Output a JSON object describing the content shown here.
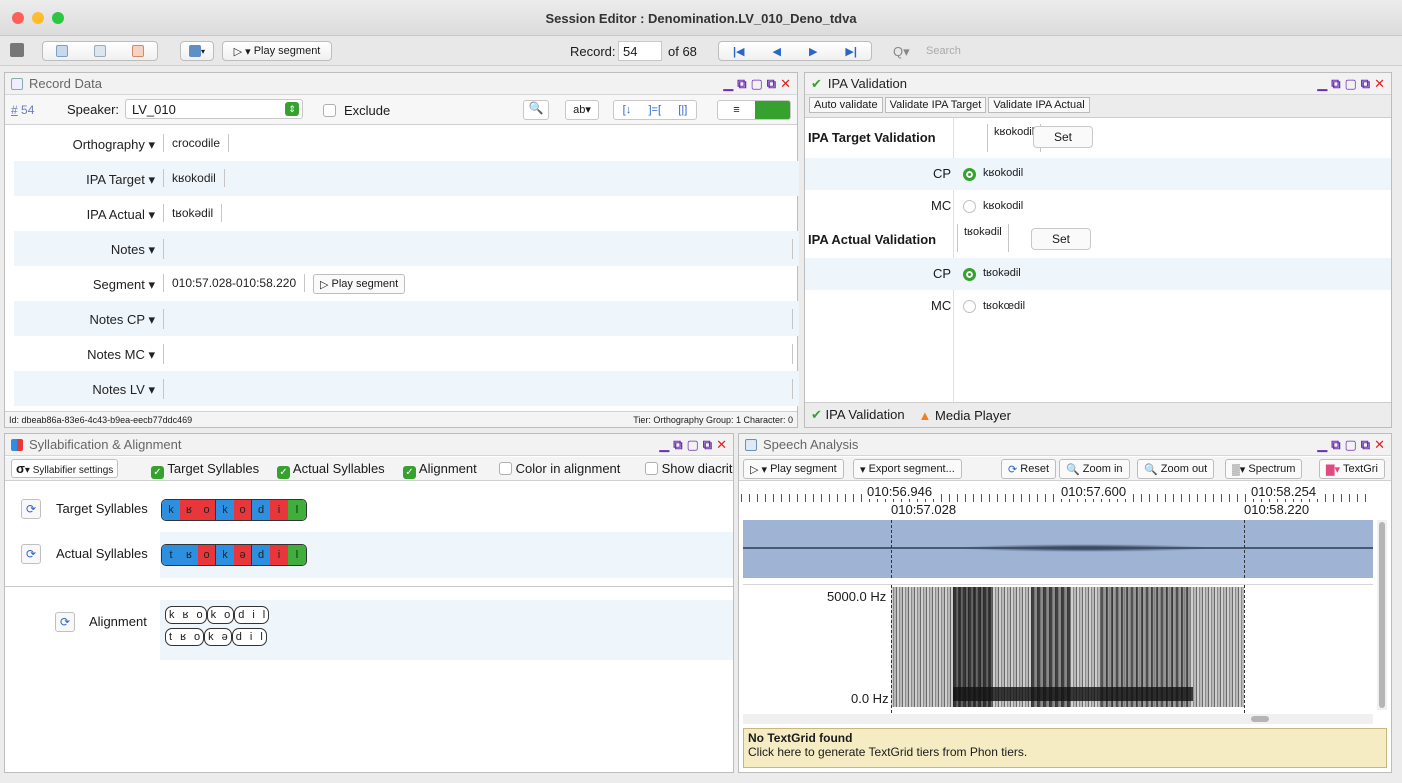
{
  "window": {
    "title": "Session Editor : Denomination.LV_010_Deno_tdva"
  },
  "toolbar": {
    "play_segment": "Play segment",
    "record_label": "Record:",
    "record_value": "54",
    "record_of": "of 68",
    "search_placeholder": "Search"
  },
  "record_data": {
    "title": "Record Data",
    "record_number": "54",
    "speaker_label": "Speaker:",
    "speaker_value": "LV_010",
    "exclude_label": "Exclude",
    "rows": [
      {
        "label": "Orthography",
        "value": "crocodile"
      },
      {
        "label": "IPA Target",
        "value": "kʁokodil"
      },
      {
        "label": "IPA Actual",
        "value": "tʁokədil"
      },
      {
        "label": "Notes",
        "value": ""
      },
      {
        "label": "Segment",
        "value": "010:57.028-010:58.220"
      },
      {
        "label": "Notes CP",
        "value": ""
      },
      {
        "label": "Notes MC",
        "value": ""
      },
      {
        "label": "Notes LV",
        "value": ""
      }
    ],
    "segment_play": "Play segment",
    "status_id": "Id: dbeab86a-83e6-4c43-b9ea-eecb77ddc469",
    "status_tier": "Tier: Orthography Group: 1  Character: 0"
  },
  "ipa_validation": {
    "title": "IPA Validation",
    "tabs": [
      "Auto validate",
      "Validate IPA Target",
      "Validate IPA Actual"
    ],
    "target_heading": "IPA Target Validation",
    "target_value": "kʁokodil",
    "actual_heading": "IPA Actual Validation",
    "actual_value": "tʁokədil",
    "set_label": "Set",
    "target_options": [
      {
        "speaker": "CP",
        "value": "kʁokodil",
        "selected": true
      },
      {
        "speaker": "MC",
        "value": "kʁokodil",
        "selected": false
      }
    ],
    "actual_options": [
      {
        "speaker": "CP",
        "value": "tʁokədil",
        "selected": true
      },
      {
        "speaker": "MC",
        "value": "tʁokœdil",
        "selected": false
      }
    ],
    "bottom_tabs": [
      "IPA Validation",
      "Media Player"
    ]
  },
  "syllabification": {
    "title": "Syllabification & Alignment",
    "settings_label": "Syllabifier settings",
    "options": [
      {
        "label": "Target Syllables",
        "checked": true
      },
      {
        "label": "Actual Syllables",
        "checked": true
      },
      {
        "label": "Alignment",
        "checked": true
      },
      {
        "label": "Color in alignment",
        "checked": false
      },
      {
        "label": "Show diacrit",
        "checked": false
      }
    ],
    "target_label": "Target Syllables",
    "actual_label": "Actual Syllables",
    "alignment_label": "Alignment",
    "target_phones": [
      "k",
      "ʁ",
      "o",
      "k",
      "o",
      "d",
      "i",
      "l"
    ],
    "actual_phones": [
      "t",
      "ʁ",
      "o",
      "k",
      "ə",
      "d",
      "i",
      "l"
    ],
    "align_top": [
      [
        "k",
        "ʁ",
        "o"
      ],
      [
        "k",
        "o"
      ],
      [
        "d",
        "i",
        "l"
      ]
    ],
    "align_bottom": [
      [
        "t",
        "ʁ",
        "o"
      ],
      [
        "k",
        "ə"
      ],
      [
        "d",
        "i",
        "l"
      ]
    ]
  },
  "speech_analysis": {
    "title": "Speech Analysis",
    "toolbar": [
      "Play segment",
      "Export segment...",
      "Reset",
      "Zoom in",
      "Zoom out",
      "Spectrum",
      "TextGri"
    ],
    "time_top": [
      "010:56.946",
      "010:57.600",
      "010:58.254"
    ],
    "time_bottom": [
      "010:57.028",
      "010:58.220"
    ],
    "freq_top": "5000.0 Hz",
    "freq_bottom": "0.0 Hz",
    "textgrid_title": "No TextGrid found",
    "textgrid_hint": "Click here to generate TextGrid tiers from Phon tiers."
  }
}
